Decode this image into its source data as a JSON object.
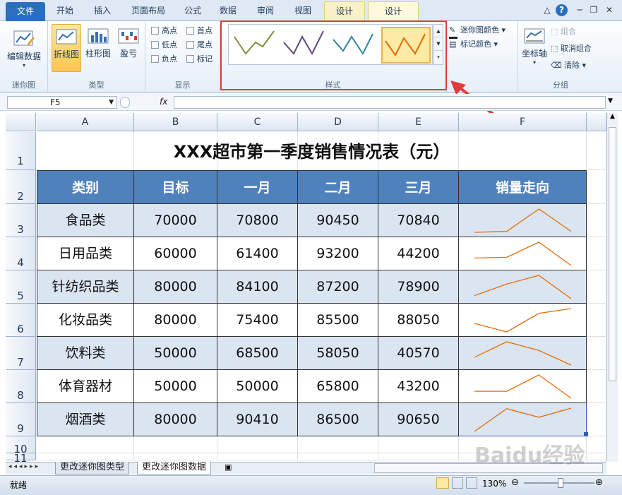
{
  "tabs": [
    "文件",
    "开始",
    "插入",
    "页面布局",
    "公式",
    "数据",
    "审阅",
    "视图",
    "设计",
    "设计"
  ],
  "ribbon": {
    "edit_data": "编辑数据",
    "line": "折线图",
    "column": "柱形图",
    "winloss": "盈亏",
    "checks": [
      "高点",
      "低点",
      "负点",
      "首点",
      "尾点",
      "标记"
    ],
    "sparkline_color": "迷你图颜色",
    "marker_color": "标记颜色",
    "axis": "坐标轴",
    "group": "组合",
    "ungroup": "取消组合",
    "clear": "清除",
    "groups": {
      "sparkline": "迷你图",
      "type": "类型",
      "show": "显示",
      "style": "样式",
      "group": "分组"
    }
  },
  "formula": {
    "cell": "F5",
    "fx": "fx"
  },
  "columns": [
    "A",
    "B",
    "C",
    "D",
    "E",
    "F"
  ],
  "rows": [
    "1",
    "2",
    "3",
    "4",
    "5",
    "6",
    "7",
    "8",
    "9",
    "10",
    "11"
  ],
  "table": {
    "title": "XXX超市第一季度销售情况表（元）",
    "headers": [
      "类别",
      "目标",
      "一月",
      "二月",
      "三月",
      "销量走向"
    ],
    "data": [
      [
        "食品类",
        "70000",
        "70800",
        "90450",
        "70840"
      ],
      [
        "日用品类",
        "60000",
        "61400",
        "93200",
        "44200"
      ],
      [
        "针纺织品类",
        "80000",
        "84100",
        "87200",
        "78900"
      ],
      [
        "化妆品类",
        "80000",
        "75400",
        "85500",
        "88050"
      ],
      [
        "饮料类",
        "50000",
        "68500",
        "58050",
        "40570"
      ],
      [
        "体育器材",
        "50000",
        "50000",
        "65800",
        "43200"
      ],
      [
        "烟酒类",
        "80000",
        "90410",
        "86500",
        "90650"
      ]
    ]
  },
  "sheets": [
    "更改迷你图类型",
    "更改迷你图数据"
  ],
  "status": {
    "ready": "就绪",
    "zoom": "130%"
  },
  "colors": {
    "header_bg": "#4f81bd",
    "band": "#dbe5f1",
    "sparkline": "#e46c0a"
  },
  "watermark": "Baidu经验"
}
